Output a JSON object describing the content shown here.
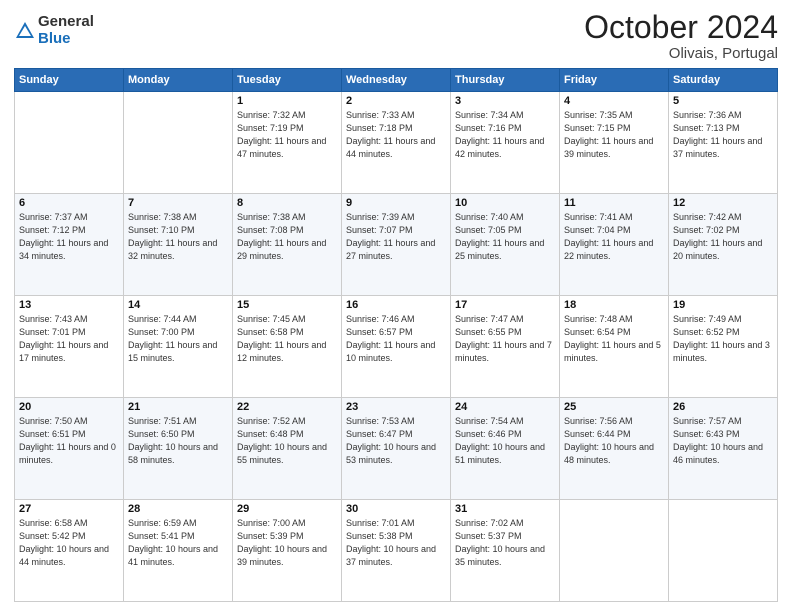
{
  "logo": {
    "general": "General",
    "blue": "Blue"
  },
  "header": {
    "month": "October 2024",
    "location": "Olivais, Portugal"
  },
  "weekdays": [
    "Sunday",
    "Monday",
    "Tuesday",
    "Wednesday",
    "Thursday",
    "Friday",
    "Saturday"
  ],
  "weeks": [
    [
      {
        "day": "",
        "sunrise": "",
        "sunset": "",
        "daylight": ""
      },
      {
        "day": "",
        "sunrise": "",
        "sunset": "",
        "daylight": ""
      },
      {
        "day": "1",
        "sunrise": "Sunrise: 7:32 AM",
        "sunset": "Sunset: 7:19 PM",
        "daylight": "Daylight: 11 hours and 47 minutes."
      },
      {
        "day": "2",
        "sunrise": "Sunrise: 7:33 AM",
        "sunset": "Sunset: 7:18 PM",
        "daylight": "Daylight: 11 hours and 44 minutes."
      },
      {
        "day": "3",
        "sunrise": "Sunrise: 7:34 AM",
        "sunset": "Sunset: 7:16 PM",
        "daylight": "Daylight: 11 hours and 42 minutes."
      },
      {
        "day": "4",
        "sunrise": "Sunrise: 7:35 AM",
        "sunset": "Sunset: 7:15 PM",
        "daylight": "Daylight: 11 hours and 39 minutes."
      },
      {
        "day": "5",
        "sunrise": "Sunrise: 7:36 AM",
        "sunset": "Sunset: 7:13 PM",
        "daylight": "Daylight: 11 hours and 37 minutes."
      }
    ],
    [
      {
        "day": "6",
        "sunrise": "Sunrise: 7:37 AM",
        "sunset": "Sunset: 7:12 PM",
        "daylight": "Daylight: 11 hours and 34 minutes."
      },
      {
        "day": "7",
        "sunrise": "Sunrise: 7:38 AM",
        "sunset": "Sunset: 7:10 PM",
        "daylight": "Daylight: 11 hours and 32 minutes."
      },
      {
        "day": "8",
        "sunrise": "Sunrise: 7:38 AM",
        "sunset": "Sunset: 7:08 PM",
        "daylight": "Daylight: 11 hours and 29 minutes."
      },
      {
        "day": "9",
        "sunrise": "Sunrise: 7:39 AM",
        "sunset": "Sunset: 7:07 PM",
        "daylight": "Daylight: 11 hours and 27 minutes."
      },
      {
        "day": "10",
        "sunrise": "Sunrise: 7:40 AM",
        "sunset": "Sunset: 7:05 PM",
        "daylight": "Daylight: 11 hours and 25 minutes."
      },
      {
        "day": "11",
        "sunrise": "Sunrise: 7:41 AM",
        "sunset": "Sunset: 7:04 PM",
        "daylight": "Daylight: 11 hours and 22 minutes."
      },
      {
        "day": "12",
        "sunrise": "Sunrise: 7:42 AM",
        "sunset": "Sunset: 7:02 PM",
        "daylight": "Daylight: 11 hours and 20 minutes."
      }
    ],
    [
      {
        "day": "13",
        "sunrise": "Sunrise: 7:43 AM",
        "sunset": "Sunset: 7:01 PM",
        "daylight": "Daylight: 11 hours and 17 minutes."
      },
      {
        "day": "14",
        "sunrise": "Sunrise: 7:44 AM",
        "sunset": "Sunset: 7:00 PM",
        "daylight": "Daylight: 11 hours and 15 minutes."
      },
      {
        "day": "15",
        "sunrise": "Sunrise: 7:45 AM",
        "sunset": "Sunset: 6:58 PM",
        "daylight": "Daylight: 11 hours and 12 minutes."
      },
      {
        "day": "16",
        "sunrise": "Sunrise: 7:46 AM",
        "sunset": "Sunset: 6:57 PM",
        "daylight": "Daylight: 11 hours and 10 minutes."
      },
      {
        "day": "17",
        "sunrise": "Sunrise: 7:47 AM",
        "sunset": "Sunset: 6:55 PM",
        "daylight": "Daylight: 11 hours and 7 minutes."
      },
      {
        "day": "18",
        "sunrise": "Sunrise: 7:48 AM",
        "sunset": "Sunset: 6:54 PM",
        "daylight": "Daylight: 11 hours and 5 minutes."
      },
      {
        "day": "19",
        "sunrise": "Sunrise: 7:49 AM",
        "sunset": "Sunset: 6:52 PM",
        "daylight": "Daylight: 11 hours and 3 minutes."
      }
    ],
    [
      {
        "day": "20",
        "sunrise": "Sunrise: 7:50 AM",
        "sunset": "Sunset: 6:51 PM",
        "daylight": "Daylight: 11 hours and 0 minutes."
      },
      {
        "day": "21",
        "sunrise": "Sunrise: 7:51 AM",
        "sunset": "Sunset: 6:50 PM",
        "daylight": "Daylight: 10 hours and 58 minutes."
      },
      {
        "day": "22",
        "sunrise": "Sunrise: 7:52 AM",
        "sunset": "Sunset: 6:48 PM",
        "daylight": "Daylight: 10 hours and 55 minutes."
      },
      {
        "day": "23",
        "sunrise": "Sunrise: 7:53 AM",
        "sunset": "Sunset: 6:47 PM",
        "daylight": "Daylight: 10 hours and 53 minutes."
      },
      {
        "day": "24",
        "sunrise": "Sunrise: 7:54 AM",
        "sunset": "Sunset: 6:46 PM",
        "daylight": "Daylight: 10 hours and 51 minutes."
      },
      {
        "day": "25",
        "sunrise": "Sunrise: 7:56 AM",
        "sunset": "Sunset: 6:44 PM",
        "daylight": "Daylight: 10 hours and 48 minutes."
      },
      {
        "day": "26",
        "sunrise": "Sunrise: 7:57 AM",
        "sunset": "Sunset: 6:43 PM",
        "daylight": "Daylight: 10 hours and 46 minutes."
      }
    ],
    [
      {
        "day": "27",
        "sunrise": "Sunrise: 6:58 AM",
        "sunset": "Sunset: 5:42 PM",
        "daylight": "Daylight: 10 hours and 44 minutes."
      },
      {
        "day": "28",
        "sunrise": "Sunrise: 6:59 AM",
        "sunset": "Sunset: 5:41 PM",
        "daylight": "Daylight: 10 hours and 41 minutes."
      },
      {
        "day": "29",
        "sunrise": "Sunrise: 7:00 AM",
        "sunset": "Sunset: 5:39 PM",
        "daylight": "Daylight: 10 hours and 39 minutes."
      },
      {
        "day": "30",
        "sunrise": "Sunrise: 7:01 AM",
        "sunset": "Sunset: 5:38 PM",
        "daylight": "Daylight: 10 hours and 37 minutes."
      },
      {
        "day": "31",
        "sunrise": "Sunrise: 7:02 AM",
        "sunset": "Sunset: 5:37 PM",
        "daylight": "Daylight: 10 hours and 35 minutes."
      },
      {
        "day": "",
        "sunrise": "",
        "sunset": "",
        "daylight": ""
      },
      {
        "day": "",
        "sunrise": "",
        "sunset": "",
        "daylight": ""
      }
    ]
  ]
}
